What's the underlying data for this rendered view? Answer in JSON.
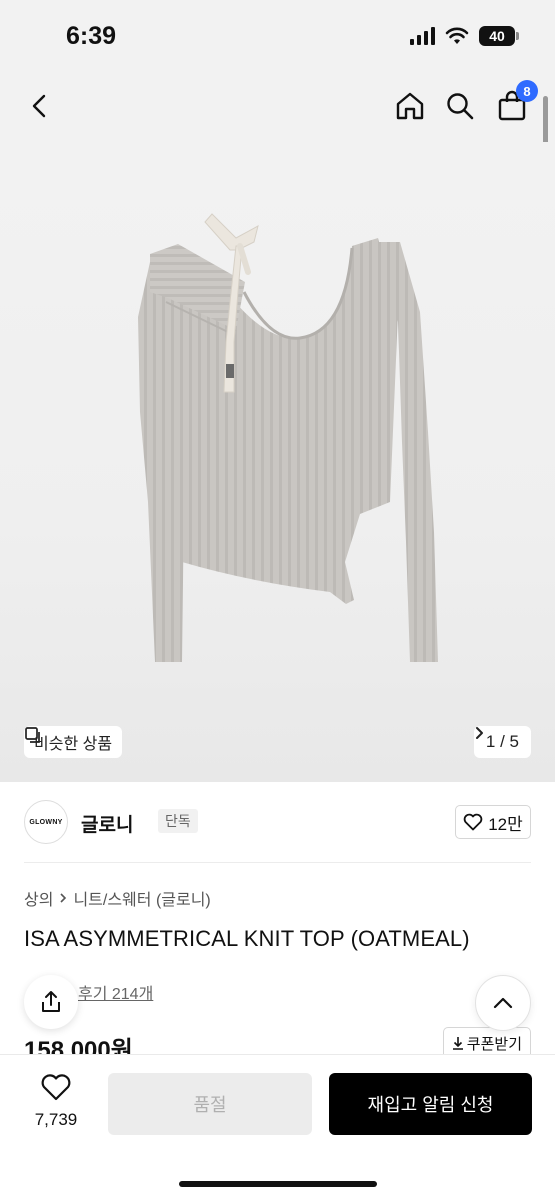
{
  "status_bar": {
    "time": "6:39",
    "battery": "40"
  },
  "nav": {
    "cart_count": "8"
  },
  "gallery": {
    "similar_label": "비슷한 상품",
    "page_indicator": "1 / 5",
    "garment_color": "#c9c6c2",
    "ribbon_color": "#ebe6de"
  },
  "brand": {
    "logo_text": "GLOWNY",
    "name": "글로니",
    "tag": "단독",
    "likes": "12만"
  },
  "product": {
    "breadcrumb": [
      "상의",
      "니트/스웨터 (글로니)"
    ],
    "title": "ISA ASYMMETRICAL KNIT TOP (OATMEAL)",
    "review_text": "후기 214개",
    "price": "158,000원",
    "coupon_label": "쿠폰받기"
  },
  "bottom_bar": {
    "wish_count": "7,739",
    "soldout_label": "품절",
    "restock_label": "재입고 알림 신청"
  },
  "colors": {
    "accent": "#2f6bff",
    "primary_button": "#000000",
    "disabled_button": "#ececec"
  }
}
